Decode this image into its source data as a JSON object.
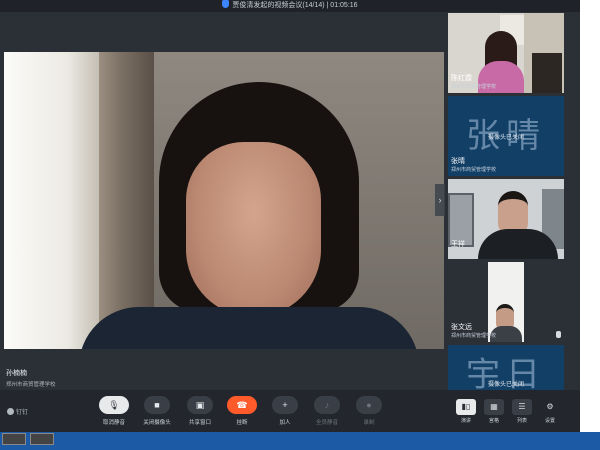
{
  "window": {
    "title": "贾俊清发起的视频会议(14/14) | 01:05:16"
  },
  "main_video": {
    "speaker_name": "孙楠楠",
    "speaker_org": "郑州市商贸管理学校"
  },
  "participants": [
    {
      "name": "陈红霞",
      "org": "郑州市商贸管理学校",
      "status": ""
    },
    {
      "name": "张晴",
      "org": "郑州市商贸管理学校",
      "status": "摄像头已关闭",
      "avatar_text": "张晴"
    },
    {
      "name": "王祥",
      "org": "",
      "status": ""
    },
    {
      "name": "张文远",
      "org": "郑州市商贸管理学校",
      "status": ""
    },
    {
      "name": "",
      "org": "",
      "status": "摄像头已关闭",
      "avatar_text": "宇日"
    }
  ],
  "toolbar": {
    "brand": "钉钉",
    "buttons": [
      {
        "label": "取消静音",
        "icon": "mic-icon"
      },
      {
        "label": "关闭摄像头",
        "icon": "camera-icon"
      },
      {
        "label": "共享窗口",
        "icon": "share-icon"
      },
      {
        "label": "挂断",
        "icon": "hangup-icon"
      },
      {
        "label": "加人",
        "icon": "add-person-icon"
      },
      {
        "label": "全员静音",
        "icon": "mute-all-icon"
      },
      {
        "label": "录制",
        "icon": "record-icon"
      }
    ],
    "layout": [
      {
        "label": "演讲",
        "icon": "speaker-layout-icon"
      },
      {
        "label": "宫格",
        "icon": "grid-layout-icon"
      },
      {
        "label": "列表",
        "icon": "list-layout-icon"
      },
      {
        "label": "设置",
        "icon": "settings-icon"
      }
    ]
  },
  "colors": {
    "hangup": "#ff5a2a",
    "tile_bg": "#123f66",
    "accent": "#3d84ff"
  }
}
